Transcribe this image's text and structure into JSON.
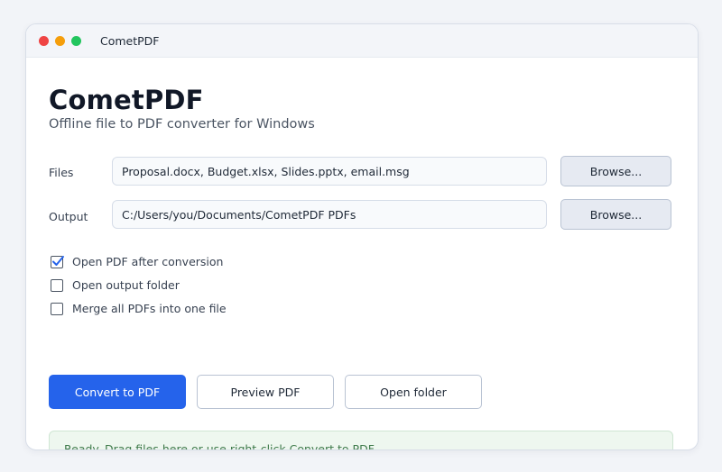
{
  "window": {
    "title": "CometPDF",
    "controls": {
      "close_color": "#ef4444",
      "minimize_color": "#f59e0b",
      "maximize_color": "#22c55e"
    }
  },
  "header": {
    "title": "CometPDF",
    "subtitle": "Offline file to PDF converter for Windows"
  },
  "files": {
    "label": "Files",
    "value": "Proposal.docx, Budget.xlsx, Slides.pptx, email.msg",
    "browse_label": "Browse..."
  },
  "output": {
    "label": "Output",
    "value": "C:/Users/you/Documents/CometPDF PDFs",
    "browse_label": "Browse..."
  },
  "options": [
    {
      "label": "Open PDF after conversion",
      "checked": true
    },
    {
      "label": "Open output folder",
      "checked": false
    },
    {
      "label": "Merge all PDFs into one file",
      "checked": false
    }
  ],
  "actions": {
    "convert_label": "Convert to PDF",
    "preview_label": "Preview PDF",
    "open_folder_label": "Open folder"
  },
  "status": {
    "text": "Ready. Drag files here or use right-click Convert to PDF."
  },
  "colors": {
    "accent": "#2563eb",
    "status_bg": "#eef7ef",
    "status_text": "#3e7a4a"
  }
}
